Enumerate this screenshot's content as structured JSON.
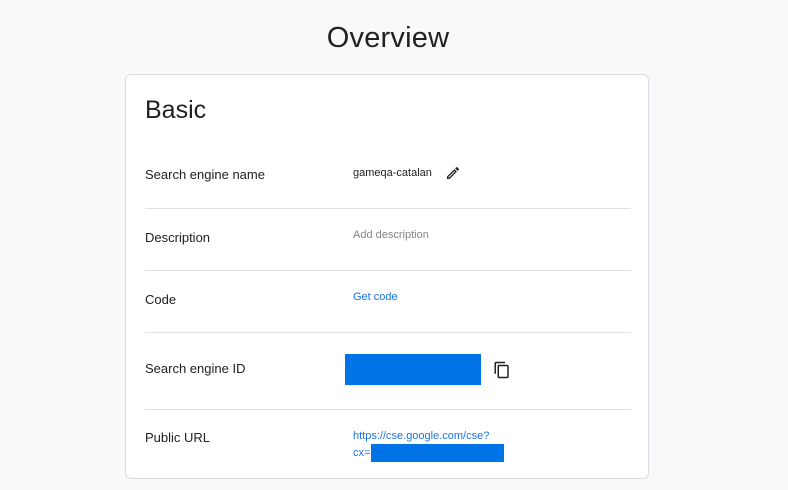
{
  "page": {
    "title": "Overview"
  },
  "basic": {
    "heading": "Basic",
    "rows": {
      "name": {
        "label": "Search engine name",
        "value": "gameqa-catalan",
        "edit_icon": "pencil-icon"
      },
      "description": {
        "label": "Description",
        "placeholder": "Add description"
      },
      "code": {
        "label": "Code",
        "link": "Get code"
      },
      "engine_id": {
        "label": "Search engine ID",
        "copy_icon": "copy-icon"
      },
      "public_url": {
        "label": "Public URL",
        "url_line1": "https://cse.google.com/cse?",
        "url_line2_prefix": "cx="
      }
    }
  },
  "colors": {
    "background": "#f8f9fa",
    "card": "#ffffff",
    "link": "#1a73e8",
    "redaction": "#0073e6",
    "divider": "#e0e0e0"
  }
}
